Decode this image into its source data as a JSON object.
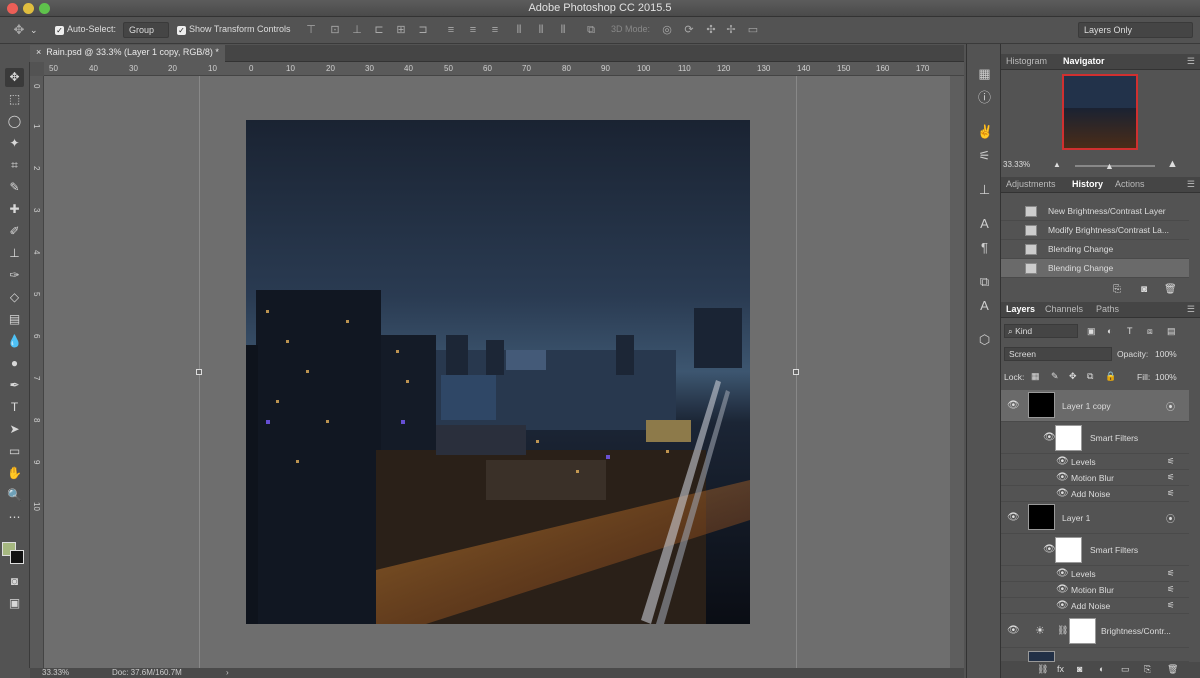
{
  "app": {
    "title": "Adobe Photoshop CC 2015.5"
  },
  "options": {
    "auto_select_label": "Auto-Select:",
    "auto_select_value": "Group",
    "transform_label": "Show Transform Controls",
    "mode3d_label": "3D Mode:",
    "workspace": "Layers Only"
  },
  "document": {
    "tab": "Rain.psd @ 33.3% (Layer 1 copy, RGB/8) *",
    "zoom": "33.33%",
    "doc_size": "Doc: 37.6M/160.7M"
  },
  "ruler": {
    "h_ticks": [
      "50",
      "40",
      "30",
      "20",
      "10",
      "0",
      "10",
      "20",
      "30",
      "40",
      "50",
      "60",
      "70",
      "80",
      "90",
      "100",
      "110",
      "120",
      "130",
      "140",
      "150",
      "160",
      "170"
    ],
    "v_ticks": [
      "0",
      "1",
      "2",
      "3",
      "4",
      "5",
      "6",
      "7",
      "8",
      "9",
      "10"
    ]
  },
  "navigator": {
    "tabs": [
      "Histogram",
      "Navigator"
    ],
    "zoom": "33.33%"
  },
  "history": {
    "tabs": [
      "Adjustments",
      "History",
      "Actions"
    ],
    "items": [
      "New Brightness/Contrast Layer",
      "Modify Brightness/Contrast La...",
      "Blending Change",
      "Blending Change"
    ]
  },
  "layers": {
    "tabs": [
      "Layers",
      "Channels",
      "Paths"
    ],
    "kind": "Kind",
    "blend_mode": "Screen",
    "opacity_label": "Opacity:",
    "opacity": "100%",
    "lock_label": "Lock:",
    "fill_label": "Fill:",
    "fill": "100%",
    "rows": [
      "Layer 1 copy",
      "Smart Filters",
      "Levels",
      "Motion Blur",
      "Add Noise",
      "Layer 1",
      "Smart Filters",
      "Levels",
      "Motion Blur",
      "Add Noise",
      "Brightness/Contr..."
    ]
  }
}
